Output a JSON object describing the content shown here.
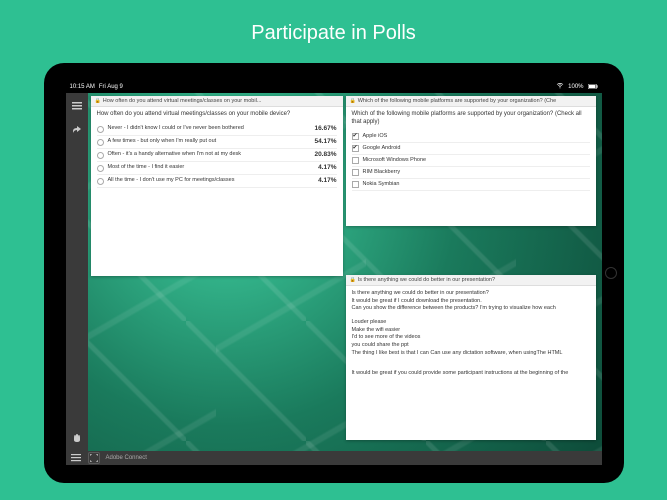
{
  "page": {
    "title": "Participate in Polls"
  },
  "status": {
    "time": "10:15 AM",
    "date": "Fri Aug 9",
    "wifi": "wifi",
    "battery": "100%"
  },
  "polls": {
    "card1": {
      "header": "How often do you attend virtual meetings/classes on your mobil...",
      "question": "How often do you attend virtual meetings/classes on your mobile device?",
      "options": [
        {
          "label": "Never - I didn't know I could or I've never been bothered",
          "pct": "16.67%"
        },
        {
          "label": "A few times - but only when I'm really put out",
          "pct": "54.17%"
        },
        {
          "label": "Often - it's a handy alternative when I'm not at my desk",
          "pct": "20.83%"
        },
        {
          "label": "Most of the time - I find it easier",
          "pct": "4.17%"
        },
        {
          "label": "All the time - I don't use my PC for meetings/classes",
          "pct": "4.17%"
        }
      ]
    },
    "card2": {
      "header": "Which of the following mobile platforms are supported by your organization? (Che",
      "question": "Which of the following mobile platforms are supported by your organization? (Check all that apply)",
      "options": [
        {
          "label": "Apple iOS",
          "checked": true
        },
        {
          "label": "Google Android",
          "checked": true
        },
        {
          "label": "Microsoft Windows Phone",
          "checked": false
        },
        {
          "label": "RIM Blackberry",
          "checked": false
        },
        {
          "label": "Nokia Symbian",
          "checked": false
        }
      ]
    },
    "card3": {
      "header": "Is there anything we could do better in our presentation?",
      "lines": [
        "Is there anything we could do better in our presentation?",
        "It would be great if I could download the presentation.",
        "Can you show the difference between the products? I'm trying to visualize how each",
        "",
        "Louder please",
        "Make the wifi easier",
        "I'd to see more of the videos",
        "you could share the ppt",
        "The thing I like best is that I can Can use any dictation software, when usingThe HTML",
        "",
        "",
        "It would be great if you could provide some participant instructions at the beginning of the"
      ]
    }
  },
  "footer": {
    "brand": "Adobe Connect"
  }
}
